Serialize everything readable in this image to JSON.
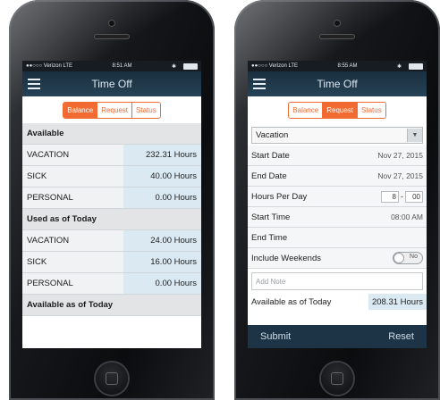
{
  "left": {
    "status": {
      "carrier": "●●○○○ Verizon  LTE",
      "time": "8:51 AM",
      "bt": "✱"
    },
    "nav_title": "Time Off",
    "tabs": [
      "Balance",
      "Request",
      "Status"
    ],
    "active_tab": 0,
    "sections": [
      {
        "header": "Available",
        "rows": [
          {
            "label": "VACATION",
            "value": "232.31 Hours"
          },
          {
            "label": "SICK",
            "value": "40.00 Hours"
          },
          {
            "label": "PERSONAL",
            "value": "0.00 Hours"
          }
        ]
      },
      {
        "header": "Used as of Today",
        "rows": [
          {
            "label": "VACATION",
            "value": "24.00 Hours"
          },
          {
            "label": "SICK",
            "value": "16.00 Hours"
          },
          {
            "label": "PERSONAL",
            "value": "0.00 Hours"
          }
        ]
      },
      {
        "header": "Available as of Today",
        "rows": []
      }
    ]
  },
  "right": {
    "status": {
      "carrier": "●●○○○ Verizon  LTE",
      "time": "8:55 AM",
      "bt": "✱"
    },
    "nav_title": "Time Off",
    "tabs": [
      "Balance",
      "Request",
      "Status"
    ],
    "active_tab": 1,
    "type_select": "Vacation",
    "start_date": {
      "label": "Start Date",
      "value": "Nov 27, 2015"
    },
    "end_date": {
      "label": "End Date",
      "value": "Nov 27, 2015"
    },
    "hours_per_day": {
      "label": "Hours Per Day",
      "hours": "8",
      "minutes": "00"
    },
    "start_time": {
      "label": "Start Time",
      "value": "08:00 AM"
    },
    "end_time": {
      "label": "End Time",
      "value": ""
    },
    "include_weekends": {
      "label": "Include Weekends",
      "toggle": "No"
    },
    "note_placeholder": "Add Note",
    "available": {
      "label": "Available as of Today",
      "value": "208.31 Hours"
    },
    "footer": {
      "submit": "Submit",
      "reset": "Reset"
    }
  }
}
